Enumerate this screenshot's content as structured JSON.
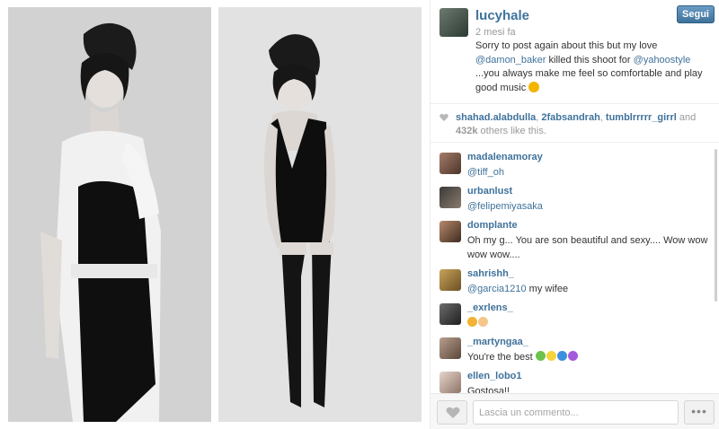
{
  "post": {
    "username": "lucyhale",
    "follow_label": "Segui",
    "time_ago": "2 mesi fa",
    "caption": {
      "text_1": "Sorry to post again about this but my love ",
      "mention_1": "@damon_baker",
      "text_2": " killed this shoot for ",
      "mention_2": "@yahoostyle",
      "text_3": " ...you always make me feel so comfortable and play good music "
    }
  },
  "likes": {
    "user_1": "shahad.alabdulla",
    "sep_1": ", ",
    "user_2": "2fabsandrah",
    "sep_2": ", ",
    "user_3": "tumblrrrrr_girrl",
    "and_text": " and ",
    "count": "432k",
    "suffix": " others like this."
  },
  "comments": [
    {
      "user": "madalenamoray",
      "text_mention": "@tiff_oh",
      "text": ""
    },
    {
      "user": "urbanlust",
      "text_mention": "@felipemiyasaka",
      "text": ""
    },
    {
      "user": "domplante",
      "text_mention": "",
      "text": "Oh my g... You are son beautiful and sexy.... Wow wow wow wow...."
    },
    {
      "user": "sahrishh_",
      "text_mention": "@garcia1210",
      "text": " my wifee"
    },
    {
      "user": "_exrlens_",
      "text_mention": "",
      "text": ""
    },
    {
      "user": "_martyngaa_",
      "text_mention": "",
      "text": "You're the best "
    },
    {
      "user": "ellen_lobo1",
      "text_mention": "",
      "text": "Gostosa!!"
    }
  ],
  "footer": {
    "comment_placeholder": "Lascia un commento...",
    "more_label": "•••"
  },
  "colors": {
    "link": "#3f729b",
    "follow_button": "#3f729b",
    "muted_text": "#999999"
  },
  "icons": {
    "like": "heart-icon",
    "likes_row": "heart-icon",
    "more": "ellipsis-icon",
    "caption_emoji": "grinning-face-emoji",
    "exrlens_emojis": [
      "thumbs-up-emoji",
      "ok-hand-emoji"
    ],
    "martyngaa_emojis": [
      "green-heart-emoji",
      "yellow-heart-emoji",
      "blue-heart-emoji",
      "purple-heart-emoji"
    ]
  }
}
